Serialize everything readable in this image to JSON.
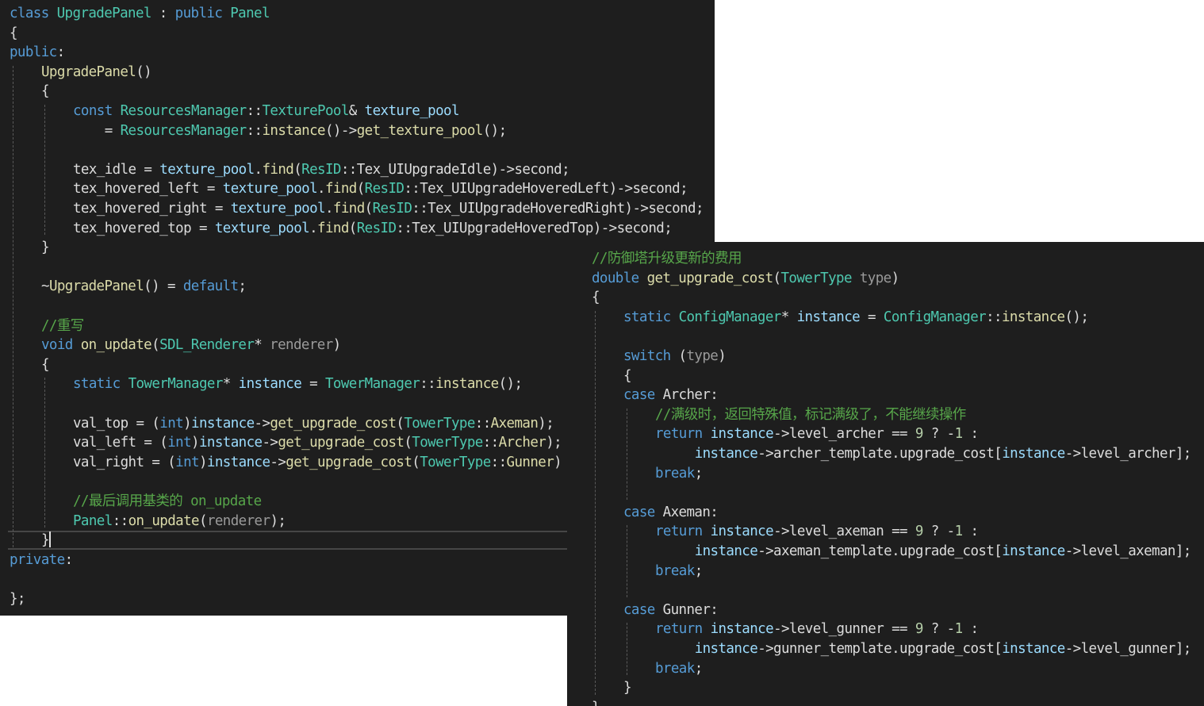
{
  "theme": {
    "background": "#1e1e1e",
    "keyword": "#569cd6",
    "type": "#4ec9b0",
    "function": "#dcdcaa",
    "variable": "#9cdcfe",
    "comment": "#57a64a",
    "param": "#9a9a9a",
    "number": "#b5cea8",
    "text": "#dcdcdc"
  },
  "left_editor": {
    "lines": [
      {
        "indent": 0,
        "tokens": [
          [
            "kw",
            "class"
          ],
          [
            "tx",
            " "
          ],
          [
            "ty",
            "UpgradePanel"
          ],
          [
            "tx",
            " : "
          ],
          [
            "kw",
            "public"
          ],
          [
            "tx",
            " "
          ],
          [
            "ty",
            "Panel"
          ]
        ]
      },
      {
        "indent": 0,
        "tokens": [
          [
            "tx",
            "{"
          ]
        ]
      },
      {
        "indent": 0,
        "tokens": [
          [
            "kw",
            "public"
          ],
          [
            "tx",
            ":"
          ]
        ]
      },
      {
        "indent": 1,
        "tokens": [
          [
            "fn",
            "UpgradePanel"
          ],
          [
            "tx",
            "()"
          ]
        ]
      },
      {
        "indent": 1,
        "tokens": [
          [
            "tx",
            "{"
          ]
        ]
      },
      {
        "indent": 2,
        "tokens": [
          [
            "kw",
            "const"
          ],
          [
            "tx",
            " "
          ],
          [
            "ty",
            "ResourcesManager"
          ],
          [
            "tx",
            "::"
          ],
          [
            "ty",
            "TexturePool"
          ],
          [
            "tx",
            "& "
          ],
          [
            "vr",
            "texture_pool"
          ]
        ]
      },
      {
        "indent": 2,
        "tokens": [
          [
            "tx",
            "    = "
          ],
          [
            "ty",
            "ResourcesManager"
          ],
          [
            "tx",
            "::"
          ],
          [
            "fn",
            "instance"
          ],
          [
            "tx",
            "()->"
          ],
          [
            "fn",
            "get_texture_pool"
          ],
          [
            "tx",
            "();"
          ]
        ]
      },
      {
        "indent": 2,
        "tokens": []
      },
      {
        "indent": 2,
        "tokens": [
          [
            "tx",
            "tex_idle = "
          ],
          [
            "vr",
            "texture_pool"
          ],
          [
            "tx",
            "."
          ],
          [
            "fn",
            "find"
          ],
          [
            "tx",
            "("
          ],
          [
            "ty",
            "ResID"
          ],
          [
            "tx",
            "::"
          ],
          [
            "tx",
            "Tex_UIUpgradeIdle"
          ],
          [
            "tx",
            ")->"
          ],
          [
            "tx",
            "second;"
          ]
        ]
      },
      {
        "indent": 2,
        "tokens": [
          [
            "tx",
            "tex_hovered_left = "
          ],
          [
            "vr",
            "texture_pool"
          ],
          [
            "tx",
            "."
          ],
          [
            "fn",
            "find"
          ],
          [
            "tx",
            "("
          ],
          [
            "ty",
            "ResID"
          ],
          [
            "tx",
            "::"
          ],
          [
            "tx",
            "Tex_UIUpgradeHoveredLeft"
          ],
          [
            "tx",
            ")->"
          ],
          [
            "tx",
            "second;"
          ]
        ]
      },
      {
        "indent": 2,
        "tokens": [
          [
            "tx",
            "tex_hovered_right = "
          ],
          [
            "vr",
            "texture_pool"
          ],
          [
            "tx",
            "."
          ],
          [
            "fn",
            "find"
          ],
          [
            "tx",
            "("
          ],
          [
            "ty",
            "ResID"
          ],
          [
            "tx",
            "::"
          ],
          [
            "tx",
            "Tex_UIUpgradeHoveredRight"
          ],
          [
            "tx",
            ")->"
          ],
          [
            "tx",
            "second;"
          ]
        ]
      },
      {
        "indent": 2,
        "tokens": [
          [
            "tx",
            "tex_hovered_top = "
          ],
          [
            "vr",
            "texture_pool"
          ],
          [
            "tx",
            "."
          ],
          [
            "fn",
            "find"
          ],
          [
            "tx",
            "("
          ],
          [
            "ty",
            "ResID"
          ],
          [
            "tx",
            "::"
          ],
          [
            "tx",
            "Tex_UIUpgradeHoveredTop"
          ],
          [
            "tx",
            ")->"
          ],
          [
            "tx",
            "second;"
          ]
        ]
      },
      {
        "indent": 1,
        "tokens": [
          [
            "tx",
            "}"
          ]
        ]
      },
      {
        "indent": 1,
        "tokens": []
      },
      {
        "indent": 1,
        "tokens": [
          [
            "tx",
            "~"
          ],
          [
            "fn",
            "UpgradePanel"
          ],
          [
            "tx",
            "() = "
          ],
          [
            "kw",
            "default"
          ],
          [
            "tx",
            ";"
          ]
        ]
      },
      {
        "indent": 1,
        "tokens": []
      },
      {
        "indent": 1,
        "tokens": [
          [
            "cm",
            "//重写"
          ]
        ]
      },
      {
        "indent": 1,
        "tokens": [
          [
            "kw",
            "void"
          ],
          [
            "tx",
            " "
          ],
          [
            "fn",
            "on_update"
          ],
          [
            "tx",
            "("
          ],
          [
            "ty",
            "SDL_Renderer"
          ],
          [
            "tx",
            "* "
          ],
          [
            "pm",
            "renderer"
          ],
          [
            "tx",
            ")"
          ]
        ]
      },
      {
        "indent": 1,
        "tokens": [
          [
            "tx",
            "{"
          ]
        ]
      },
      {
        "indent": 2,
        "tokens": [
          [
            "kw",
            "static"
          ],
          [
            "tx",
            " "
          ],
          [
            "ty",
            "TowerManager"
          ],
          [
            "tx",
            "* "
          ],
          [
            "vr",
            "instance"
          ],
          [
            "tx",
            " = "
          ],
          [
            "ty",
            "TowerManager"
          ],
          [
            "tx",
            "::"
          ],
          [
            "fn",
            "instance"
          ],
          [
            "tx",
            "();"
          ]
        ]
      },
      {
        "indent": 2,
        "tokens": []
      },
      {
        "indent": 2,
        "tokens": [
          [
            "tx",
            "val_top = ("
          ],
          [
            "kw",
            "int"
          ],
          [
            "tx",
            ")"
          ],
          [
            "vr",
            "instance"
          ],
          [
            "tx",
            "->"
          ],
          [
            "fn",
            "get_upgrade_cost"
          ],
          [
            "tx",
            "("
          ],
          [
            "ty",
            "TowerType"
          ],
          [
            "tx",
            "::"
          ],
          [
            "fn",
            "Axeman"
          ],
          [
            "tx",
            ");"
          ]
        ]
      },
      {
        "indent": 2,
        "tokens": [
          [
            "tx",
            "val_left = ("
          ],
          [
            "kw",
            "int"
          ],
          [
            "tx",
            ")"
          ],
          [
            "vr",
            "instance"
          ],
          [
            "tx",
            "->"
          ],
          [
            "fn",
            "get_upgrade_cost"
          ],
          [
            "tx",
            "("
          ],
          [
            "ty",
            "TowerType"
          ],
          [
            "tx",
            "::"
          ],
          [
            "fn",
            "Archer"
          ],
          [
            "tx",
            ");"
          ]
        ]
      },
      {
        "indent": 2,
        "tokens": [
          [
            "tx",
            "val_right = ("
          ],
          [
            "kw",
            "int"
          ],
          [
            "tx",
            ")"
          ],
          [
            "vr",
            "instance"
          ],
          [
            "tx",
            "->"
          ],
          [
            "fn",
            "get_upgrade_cost"
          ],
          [
            "tx",
            "("
          ],
          [
            "ty",
            "TowerType"
          ],
          [
            "tx",
            "::"
          ],
          [
            "fn",
            "Gunner"
          ],
          [
            "tx",
            ")"
          ]
        ]
      },
      {
        "indent": 2,
        "tokens": []
      },
      {
        "indent": 2,
        "tokens": [
          [
            "cm",
            "//最后调用基类的 on_update"
          ]
        ]
      },
      {
        "indent": 2,
        "tokens": [
          [
            "ty",
            "Panel"
          ],
          [
            "tx",
            "::"
          ],
          [
            "fn",
            "on_update"
          ],
          [
            "tx",
            "("
          ],
          [
            "pm",
            "renderer"
          ],
          [
            "tx",
            ");"
          ]
        ]
      },
      {
        "indent": 1,
        "tokens": [
          [
            "tx",
            "}"
          ]
        ]
      },
      {
        "indent": 0,
        "tokens": [
          [
            "kw",
            "private"
          ],
          [
            "tx",
            ":"
          ]
        ]
      },
      {
        "indent": 0,
        "tokens": []
      },
      {
        "indent": 0,
        "tokens": [
          [
            "tx",
            "};"
          ]
        ]
      }
    ]
  },
  "right_editor": {
    "lines": [
      {
        "indent": 0,
        "tokens": [
          [
            "cm",
            "//防御塔升级更新的费用"
          ]
        ]
      },
      {
        "indent": 0,
        "tokens": [
          [
            "kw",
            "double"
          ],
          [
            "tx",
            " "
          ],
          [
            "fn",
            "get_upgrade_cost"
          ],
          [
            "tx",
            "("
          ],
          [
            "ty",
            "TowerType"
          ],
          [
            "tx",
            " "
          ],
          [
            "pm",
            "type"
          ],
          [
            "tx",
            ")"
          ]
        ]
      },
      {
        "indent": 0,
        "tokens": [
          [
            "tx",
            "{"
          ]
        ]
      },
      {
        "indent": 1,
        "tokens": [
          [
            "kw",
            "static"
          ],
          [
            "tx",
            " "
          ],
          [
            "ty",
            "ConfigManager"
          ],
          [
            "tx",
            "* "
          ],
          [
            "vr",
            "instance"
          ],
          [
            "tx",
            " = "
          ],
          [
            "ty",
            "ConfigManager"
          ],
          [
            "tx",
            "::"
          ],
          [
            "fn",
            "instance"
          ],
          [
            "tx",
            "();"
          ]
        ]
      },
      {
        "indent": 1,
        "tokens": []
      },
      {
        "indent": 1,
        "tokens": [
          [
            "kw",
            "switch"
          ],
          [
            "tx",
            " ("
          ],
          [
            "pm",
            "type"
          ],
          [
            "tx",
            ")"
          ]
        ]
      },
      {
        "indent": 1,
        "tokens": [
          [
            "tx",
            "{"
          ]
        ]
      },
      {
        "indent": 1,
        "tokens": [
          [
            "kw",
            "case"
          ],
          [
            "tx",
            " Archer:"
          ]
        ]
      },
      {
        "indent": 2,
        "tokens": [
          [
            "cm",
            "//满级时，返回特殊值，标记满级了，不能继续操作"
          ]
        ]
      },
      {
        "indent": 2,
        "tokens": [
          [
            "kw",
            "return"
          ],
          [
            "tx",
            " "
          ],
          [
            "vr",
            "instance"
          ],
          [
            "tx",
            "->level_archer == "
          ],
          [
            "nm",
            "9"
          ],
          [
            "tx",
            " ? -"
          ],
          [
            "nm",
            "1"
          ],
          [
            "tx",
            " :"
          ]
        ]
      },
      {
        "indent": 2,
        "tokens": [
          [
            "tx",
            "     "
          ],
          [
            "vr",
            "instance"
          ],
          [
            "tx",
            "->archer_template."
          ],
          [
            "tx",
            "upgrade_cost["
          ],
          [
            "vr",
            "instance"
          ],
          [
            "tx",
            "->level_archer];"
          ]
        ]
      },
      {
        "indent": 2,
        "tokens": [
          [
            "kw",
            "break"
          ],
          [
            "tx",
            ";"
          ]
        ]
      },
      {
        "indent": 2,
        "tokens": []
      },
      {
        "indent": 1,
        "tokens": [
          [
            "kw",
            "case"
          ],
          [
            "tx",
            " Axeman:"
          ]
        ]
      },
      {
        "indent": 2,
        "tokens": [
          [
            "kw",
            "return"
          ],
          [
            "tx",
            " "
          ],
          [
            "vr",
            "instance"
          ],
          [
            "tx",
            "->level_axeman == "
          ],
          [
            "nm",
            "9"
          ],
          [
            "tx",
            " ? -"
          ],
          [
            "nm",
            "1"
          ],
          [
            "tx",
            " :"
          ]
        ]
      },
      {
        "indent": 2,
        "tokens": [
          [
            "tx",
            "     "
          ],
          [
            "vr",
            "instance"
          ],
          [
            "tx",
            "->axeman_template."
          ],
          [
            "tx",
            "upgrade_cost["
          ],
          [
            "vr",
            "instance"
          ],
          [
            "tx",
            "->level_axeman];"
          ]
        ]
      },
      {
        "indent": 2,
        "tokens": [
          [
            "kw",
            "break"
          ],
          [
            "tx",
            ";"
          ]
        ]
      },
      {
        "indent": 2,
        "tokens": []
      },
      {
        "indent": 1,
        "tokens": [
          [
            "kw",
            "case"
          ],
          [
            "tx",
            " Gunner:"
          ]
        ]
      },
      {
        "indent": 2,
        "tokens": [
          [
            "kw",
            "return"
          ],
          [
            "tx",
            " "
          ],
          [
            "vr",
            "instance"
          ],
          [
            "tx",
            "->level_gunner == "
          ],
          [
            "nm",
            "9"
          ],
          [
            "tx",
            " ? -"
          ],
          [
            "nm",
            "1"
          ],
          [
            "tx",
            " :"
          ]
        ]
      },
      {
        "indent": 2,
        "tokens": [
          [
            "tx",
            "     "
          ],
          [
            "vr",
            "instance"
          ],
          [
            "tx",
            "->gunner_template."
          ],
          [
            "tx",
            "upgrade_cost["
          ],
          [
            "vr",
            "instance"
          ],
          [
            "tx",
            "->level_gunner];"
          ]
        ]
      },
      {
        "indent": 2,
        "tokens": [
          [
            "kw",
            "break"
          ],
          [
            "tx",
            ";"
          ]
        ]
      },
      {
        "indent": 1,
        "tokens": [
          [
            "tx",
            "}"
          ]
        ]
      },
      {
        "indent": 0,
        "tokens": [
          [
            "tx",
            "}"
          ]
        ]
      }
    ]
  }
}
